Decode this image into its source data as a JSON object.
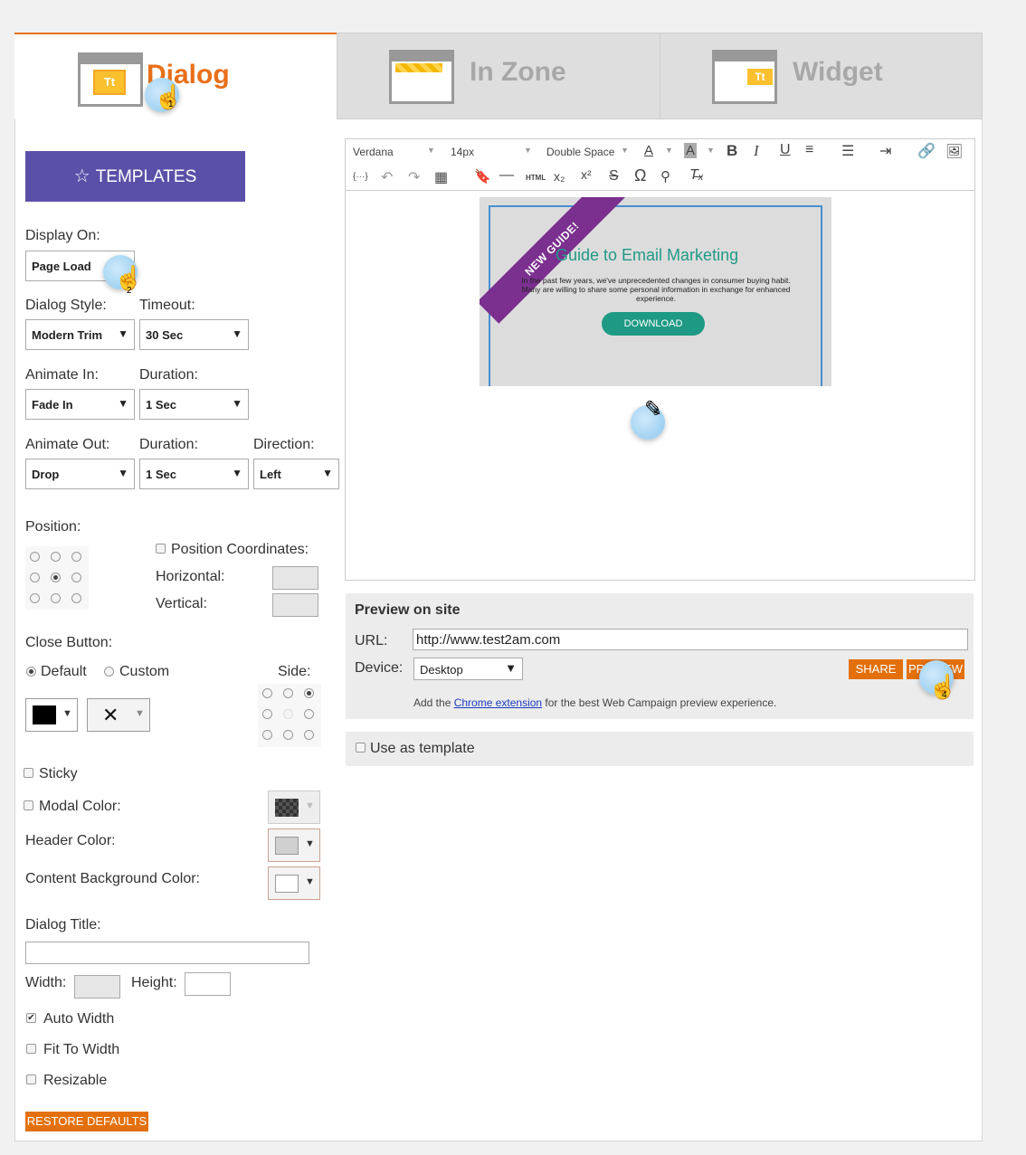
{
  "tabs": [
    {
      "label": "Dialog",
      "icon_text": "Tt",
      "active": true
    },
    {
      "label": "In Zone",
      "active": false
    },
    {
      "label": "Widget",
      "icon_text": "Tt",
      "active": false
    }
  ],
  "templates_button": "TEMPLATES",
  "display_on": {
    "label": "Display On:",
    "value": "Page Load"
  },
  "dialog_style": {
    "label": "Dialog Style:",
    "value": "Modern Trim"
  },
  "timeout": {
    "label": "Timeout:",
    "value": "30 Sec"
  },
  "animate_in": {
    "label": "Animate In:",
    "value": "Fade In"
  },
  "duration_in": {
    "label": "Duration:",
    "value": "1 Sec"
  },
  "animate_out": {
    "label": "Animate Out:",
    "value": "Drop"
  },
  "duration_out": {
    "label": "Duration:",
    "value": "1 Sec"
  },
  "direction": {
    "label": "Direction:",
    "value": "Left"
  },
  "position": {
    "label": "Position:"
  },
  "position_coordinates": {
    "label": "Position Coordinates:",
    "horizontal": "Horizontal:",
    "vertical": "Vertical:"
  },
  "close_button": {
    "label": "Close Button:",
    "default": "Default",
    "custom": "Custom",
    "side": "Side:",
    "symbol": "✕"
  },
  "sticky": "Sticky",
  "modal_color": "Modal Color:",
  "header_color": "Header Color:",
  "content_bg_color": "Content Background Color:",
  "dialog_title": "Dialog Title:",
  "width": "Width:",
  "height": "Height:",
  "auto_width": "Auto Width",
  "fit_to_width": "Fit To Width",
  "resizable": "Resizable",
  "restore_defaults": "RESTORE DEFAULTS",
  "editor": {
    "font": "Verdana",
    "size": "14px",
    "spacing": "Double Space",
    "braces": "{···}",
    "html": "HTML"
  },
  "email_card": {
    "ribbon": "NEW GUIDE!",
    "title": "Guide to Email Marketing",
    "body": "In the past few years, we've unprecedented changes in consumer buying habit. Many are willing to share some personal information in exchange for enhanced experience.",
    "button": "DOWNLOAD"
  },
  "preview": {
    "title": "Preview on site",
    "url_label": "URL:",
    "url_value": "http://www.test2am.com",
    "device_label": "Device:",
    "device_value": "Desktop",
    "share": "SHARE",
    "preview": "PREVIEW",
    "note_prefix": "Add the ",
    "note_link": "Chrome extension",
    "note_suffix": " for the best Web Campaign preview experience."
  },
  "use_as_template": "Use as template",
  "step_numbers": [
    "1",
    "2",
    "3",
    "4"
  ],
  "colors": {
    "accent": "#e8701a",
    "templates_bg": "#5b50a8",
    "ribbon": "#7b2f8f",
    "download": "#1e9a84",
    "card_title": "#1f9a88"
  }
}
